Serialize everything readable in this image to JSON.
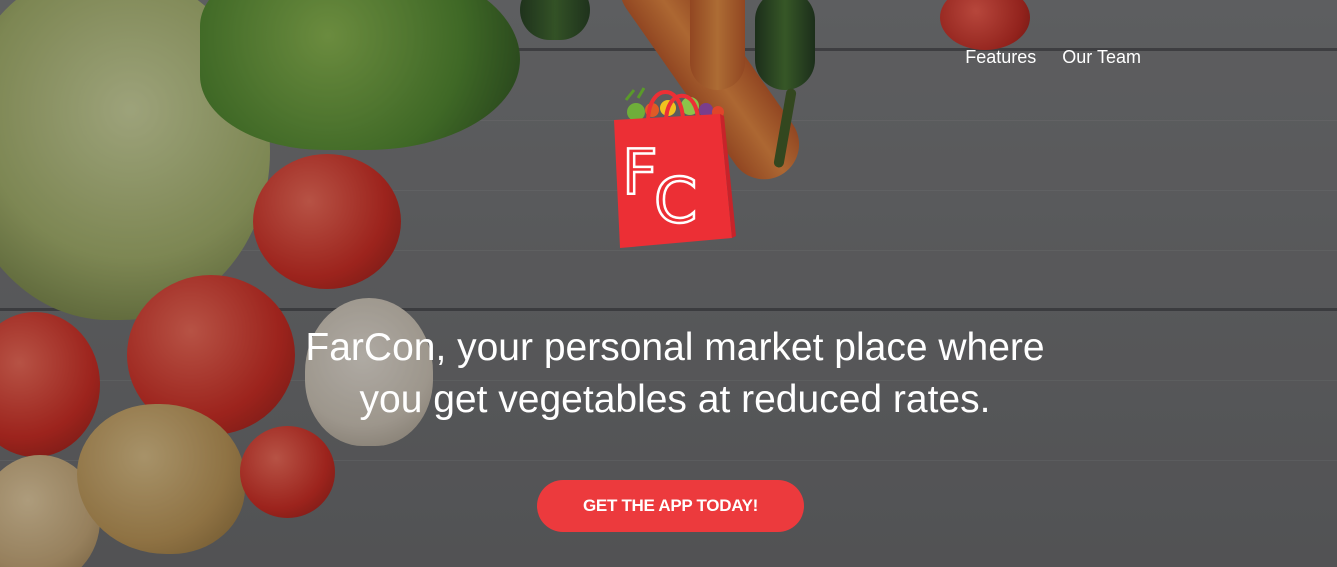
{
  "nav": {
    "items": [
      {
        "label": "Features"
      },
      {
        "label": "Our Team"
      }
    ]
  },
  "logo": {
    "letters": "FC",
    "brand_color": "#ec2f35"
  },
  "hero": {
    "headline_line1": "FarCon, your personal market place where",
    "headline_line2": "you get vegetables at reduced rates.",
    "cta_label": "GET THE APP TODAY!"
  },
  "colors": {
    "accent": "#ec3a3d",
    "text": "#ffffff"
  }
}
